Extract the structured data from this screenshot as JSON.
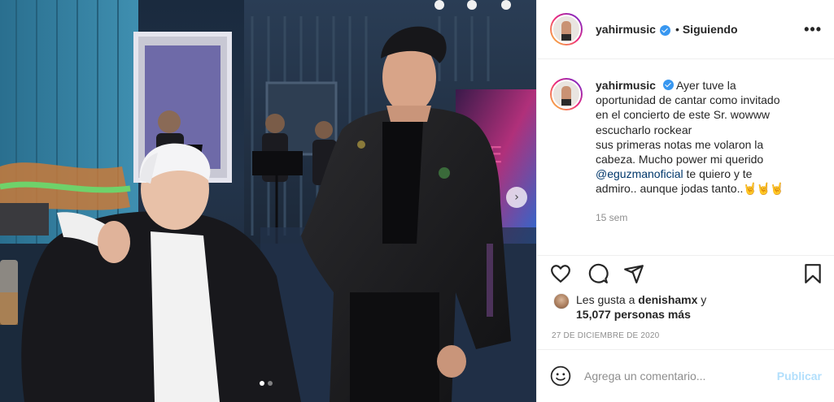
{
  "post": {
    "image_alt": "",
    "carousel_next_glyph": "›",
    "carousel_count": 2,
    "carousel_active": 0
  },
  "header": {
    "username": "yahirmusic",
    "separator": "•",
    "follow_status": "Siguiendo",
    "more_glyph": "•••"
  },
  "caption": {
    "username": "yahirmusic",
    "line1": "Ayer tuve la",
    "line2": "oportunidad de cantar como invitado",
    "line3": "en el concierto de este Sr. wowww",
    "line4": "escucharlo rockear",
    "line5": "sus primeras notas me volaron la",
    "line6": "cabeza. Mucho power mi querido",
    "mention": "@eguzmanoficial",
    "line7_rest": " te quiero y te",
    "line8": "admiro.. aunque jodas tanto..",
    "emojis": "🤘🤘🤘",
    "time_ago": "15 sem"
  },
  "actions": {
    "like_icon": "heart-icon",
    "comment_icon": "comment-icon",
    "share_icon": "share-icon",
    "save_icon": "bookmark-icon"
  },
  "likes": {
    "prefix": "Les gusta a ",
    "first_user": "denishamx",
    "connector": " y",
    "others": "15,077 personas más"
  },
  "date": "27 DE DICIEMBRE DE 2020",
  "comment": {
    "placeholder": "Agrega un comentario...",
    "publish_label": "Publicar"
  },
  "colors": {
    "link": "#00376b",
    "verified": "#3897f0",
    "publish_disabled": "#b2dffc",
    "muted": "#8e8e8e"
  }
}
